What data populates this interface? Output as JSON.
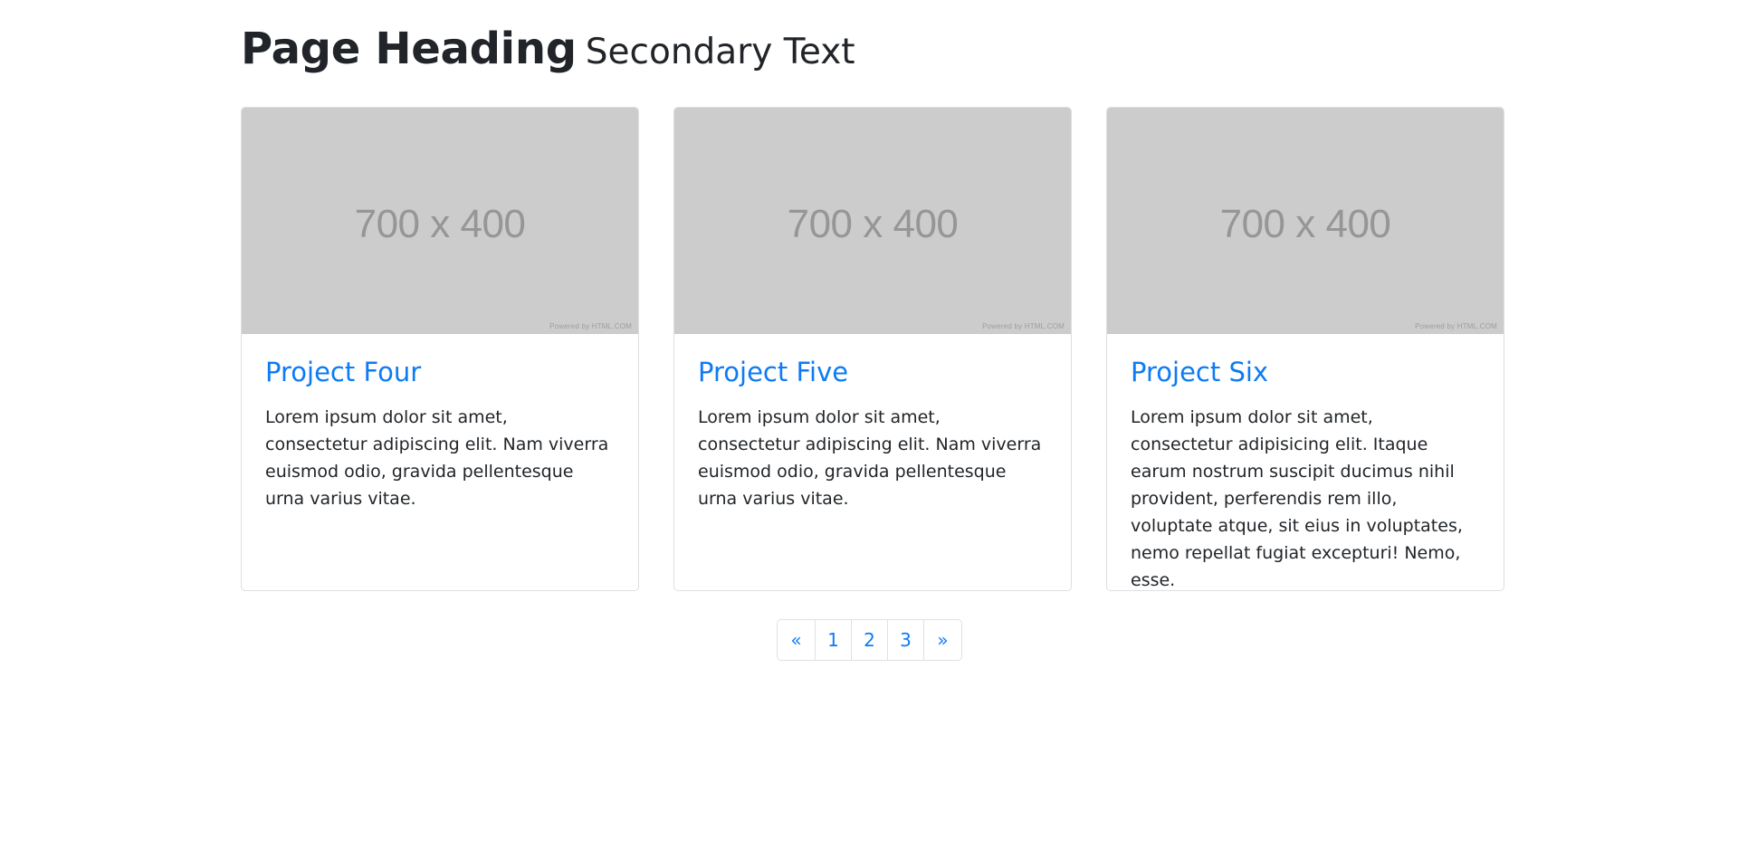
{
  "header": {
    "title": "Page Heading",
    "subtitle": "Secondary Text"
  },
  "colors": {
    "link": "#0d7bf5",
    "text": "#212529",
    "placeholder_bg": "#cccccc",
    "border": "#dee2e6"
  },
  "cards": [
    {
      "image_label": "700 x 400",
      "image_credit": "Powered by HTML.COM",
      "title": "Project Four",
      "text": "Lorem ipsum dolor sit amet, consectetur adipiscing elit. Nam viverra euismod odio, gravida pellentesque urna varius vitae."
    },
    {
      "image_label": "700 x 400",
      "image_credit": "Powered by HTML.COM",
      "title": "Project Five",
      "text": "Lorem ipsum dolor sit amet, consectetur adipiscing elit. Nam viverra euismod odio, gravida pellentesque urna varius vitae."
    },
    {
      "image_label": "700 x 400",
      "image_credit": "Powered by HTML.COM",
      "title": "Project Six",
      "text": "Lorem ipsum dolor sit amet, consectetur adipisicing elit. Itaque earum nostrum suscipit ducimus nihil provident, perferendis rem illo, voluptate atque, sit eius in voluptates, nemo repellat fugiat excepturi! Nemo, esse."
    }
  ],
  "pagination": {
    "prev": "«",
    "pages": [
      "1",
      "2",
      "3"
    ],
    "next": "»"
  }
}
